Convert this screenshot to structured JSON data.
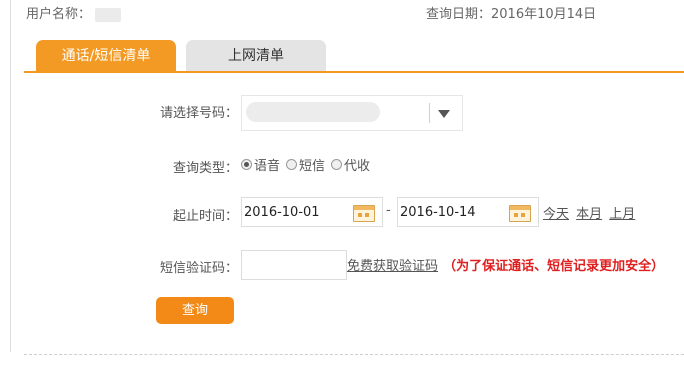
{
  "header": {
    "user_label": "用户名称：",
    "query_date_label": "查询日期：",
    "query_date_value": "2016年10月14日"
  },
  "tabs": [
    {
      "label": "通话/短信清单",
      "active": true
    },
    {
      "label": "上网清单",
      "active": false
    }
  ],
  "form": {
    "number_label": "请选择号码：",
    "type_label": "查询类型：",
    "type_options": [
      {
        "label": "语音",
        "checked": true
      },
      {
        "label": "短信",
        "checked": false
      },
      {
        "label": "代收",
        "checked": false
      }
    ],
    "period_label": "起止时间：",
    "start_date": "2016-10-01",
    "date_separator": "-",
    "end_date": "2016-10-14",
    "quick_links": [
      "今天",
      "本月",
      "上月"
    ],
    "sms_code_label": "短信验证码：",
    "sms_code_value": "",
    "get_code_link": "免费获取验证码",
    "warning": "（为了保证通话、短信记录更加安全）",
    "submit_label": "查询"
  },
  "colors": {
    "accent": "#f39a24",
    "warning": "#e02020",
    "tab_inactive": "#e4e4e4"
  },
  "icons": [
    "calendar-icon",
    "chevron-down-icon"
  ]
}
